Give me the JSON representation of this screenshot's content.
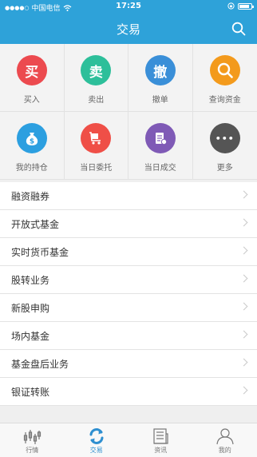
{
  "status_bar": {
    "carrier": "中国电信",
    "time": "17:25",
    "battery_level": 0.85
  },
  "header": {
    "title": "交易"
  },
  "quick_actions": [
    {
      "glyph": "买",
      "label": "买入",
      "color": "#ec4a4f",
      "icon": "buy-icon"
    },
    {
      "glyph": "卖",
      "label": "卖出",
      "color": "#2dbf9a",
      "icon": "sell-icon"
    },
    {
      "glyph": "撤",
      "label": "撤单",
      "color": "#3a8fd8",
      "icon": "cancel-order-icon"
    },
    {
      "glyph": "",
      "label": "查询资金",
      "color": "#f39a1c",
      "icon": "search-funds-icon"
    },
    {
      "glyph": "",
      "label": "我的持仓",
      "color": "#2c9fe0",
      "icon": "money-bag-icon"
    },
    {
      "glyph": "",
      "label": "当日委托",
      "color": "#ef4f47",
      "icon": "cart-icon"
    },
    {
      "glyph": "",
      "label": "当日成交",
      "color": "#7f5ab6",
      "icon": "coins-icon"
    },
    {
      "glyph": "•••",
      "label": "更多",
      "color": "#555555",
      "icon": "more-icon"
    }
  ],
  "menu_items": [
    "融资融券",
    "开放式基金",
    "实时货币基金",
    "股转业务",
    "新股申购",
    "场内基金",
    "基金盘后业务",
    "银证转账"
  ],
  "tab_bar": [
    {
      "label": "行情",
      "icon": "market-chart-icon",
      "active": false
    },
    {
      "label": "交易",
      "icon": "trade-exchange-icon",
      "active": true
    },
    {
      "label": "资讯",
      "icon": "news-icon",
      "active": false
    },
    {
      "label": "我的",
      "icon": "profile-icon",
      "active": false
    }
  ]
}
